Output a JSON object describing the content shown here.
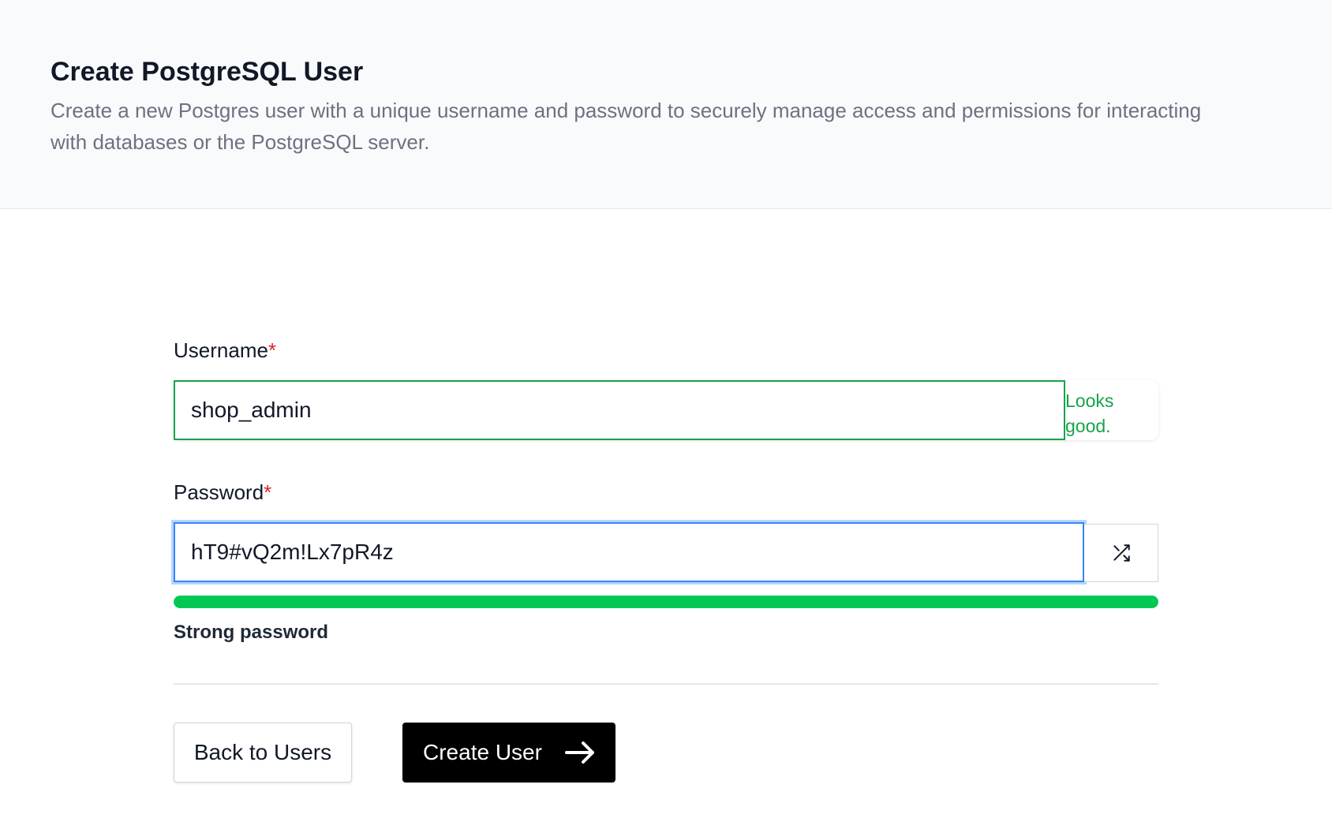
{
  "header": {
    "title": "Create PostgreSQL User",
    "description": "Create a new Postgres user with a unique username and password to securely manage access and permissions for interacting with databases or the PostgreSQL server."
  },
  "form": {
    "username": {
      "label": "Username",
      "required_mark": "*",
      "value": "shop_admin",
      "feedback": "Looks good."
    },
    "password": {
      "label": "Password",
      "required_mark": "*",
      "value": "hT9#vQ2m!Lx7pR4z",
      "generate_icon": "shuffle-icon",
      "strength_percent": 100,
      "strength_text": "Strong password",
      "strength_color": "#00c853"
    }
  },
  "actions": {
    "back_label": "Back to Users",
    "create_label": "Create User",
    "create_icon": "arrow-right-icon"
  },
  "colors": {
    "valid": "#16a34a",
    "focus": "#3b82f6",
    "required": "#dc2626",
    "primary_button": "#000000"
  }
}
